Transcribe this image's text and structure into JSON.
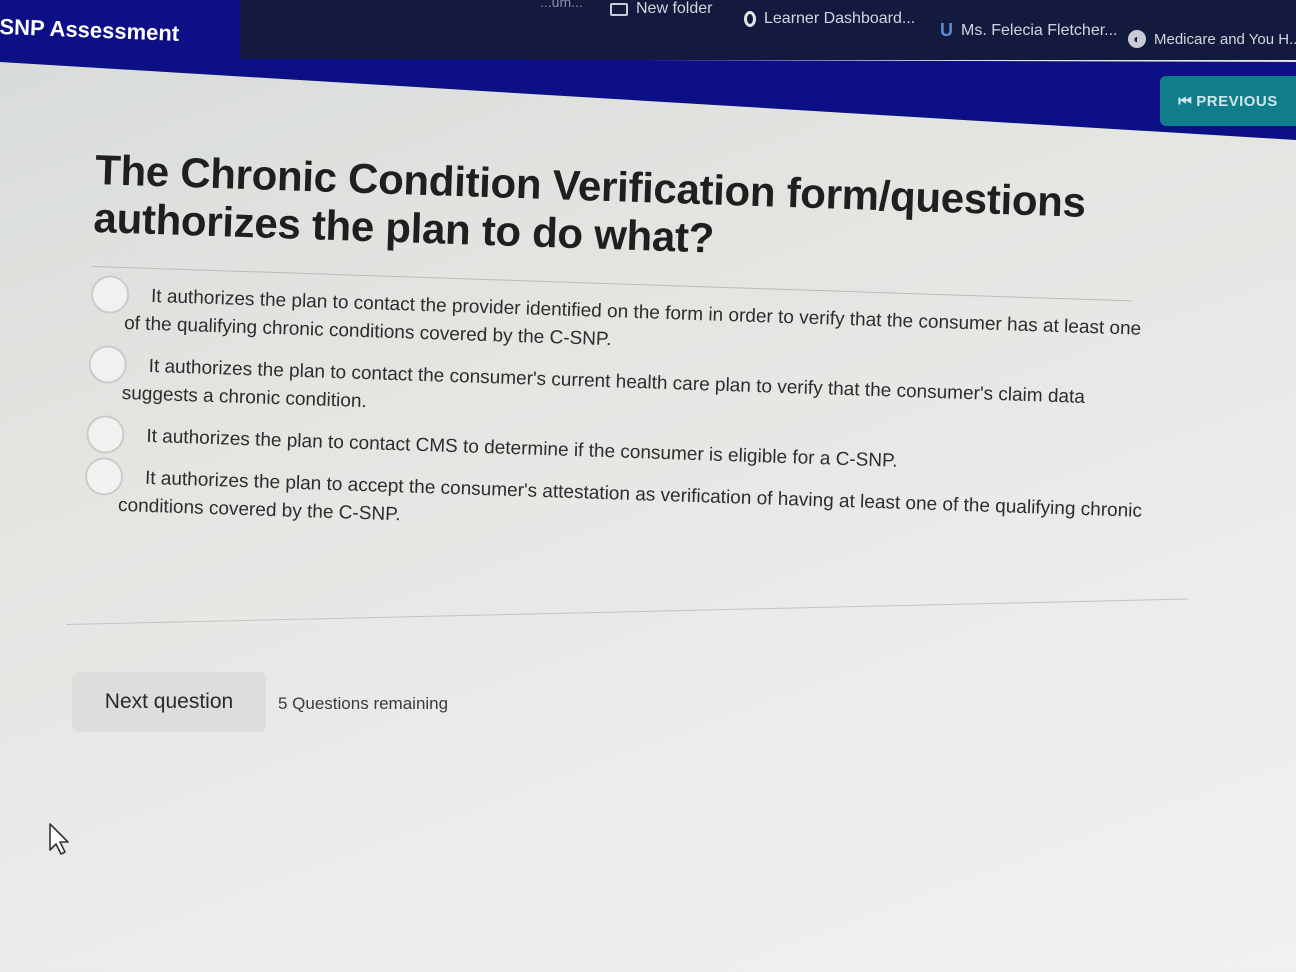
{
  "bookmarks": {
    "partial": "...um...",
    "items": [
      {
        "label": "New folder",
        "icon": "folder-icon"
      },
      {
        "label": "Learner Dashboard...",
        "icon": "learner-icon"
      },
      {
        "label": "Ms. Felecia Fletcher...",
        "icon": "magnet-icon"
      },
      {
        "label": "Medicare and You H...",
        "icon": "globe-icon"
      }
    ]
  },
  "header": {
    "title": "SNP Assessment",
    "previous_label": "PREVIOUS",
    "previous_icon": "⏮"
  },
  "question": {
    "title": "The Chronic Condition Verification form/questions authorizes the plan to do what?",
    "options": [
      {
        "text": "It authorizes the plan to contact the provider identified on the form in order to verify that the consumer has at least one of the qualifying chronic conditions covered by the C-SNP."
      },
      {
        "text": "It authorizes the plan to contact the consumer's current health care plan to verify that the consumer's claim data suggests a chronic condition."
      },
      {
        "text": "It authorizes the plan to contact CMS to determine if the consumer is eligible for a C-SNP."
      },
      {
        "text": "It authorizes the plan to accept the consumer's attestation as verification of having at least one of the qualifying chronic conditions covered by the C-SNP."
      }
    ]
  },
  "footer": {
    "next_label": "Next question",
    "remaining": "5 Questions remaining"
  },
  "colors": {
    "header": "#0c0f86",
    "previous_button": "#0f7d8a",
    "bookmarks_bar": "#141a3e"
  }
}
